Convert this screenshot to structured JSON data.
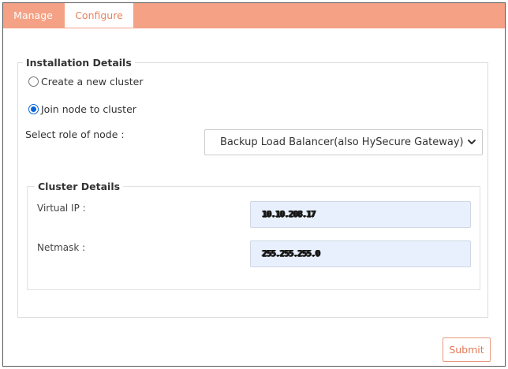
{
  "tabs": [
    {
      "label": "Manage",
      "active": false
    },
    {
      "label": "Configure",
      "active": true
    }
  ],
  "installation": {
    "legend": "Installation Details",
    "options": [
      {
        "label": "Create a new cluster",
        "selected": false
      },
      {
        "label": "Join node to cluster",
        "selected": true
      }
    ],
    "role_label": "Select role of node :",
    "role_value": "Backup Load Balancer(also HySecure Gateway)"
  },
  "cluster": {
    "legend": "Cluster Details",
    "virtual_ip_label": "Virtual IP :",
    "virtual_ip_value": "10.10.208.17",
    "netmask_label": "Netmask :",
    "netmask_value": "255.255.255.0"
  },
  "submit_label": "Submit",
  "colors": {
    "accent": "#f4a185",
    "accent_text": "#e8825f",
    "autofill_bg": "#e8f0fe",
    "radio_checked": "#0a64d8"
  },
  "icons": {
    "select_arrow": "chevron-down-icon"
  }
}
